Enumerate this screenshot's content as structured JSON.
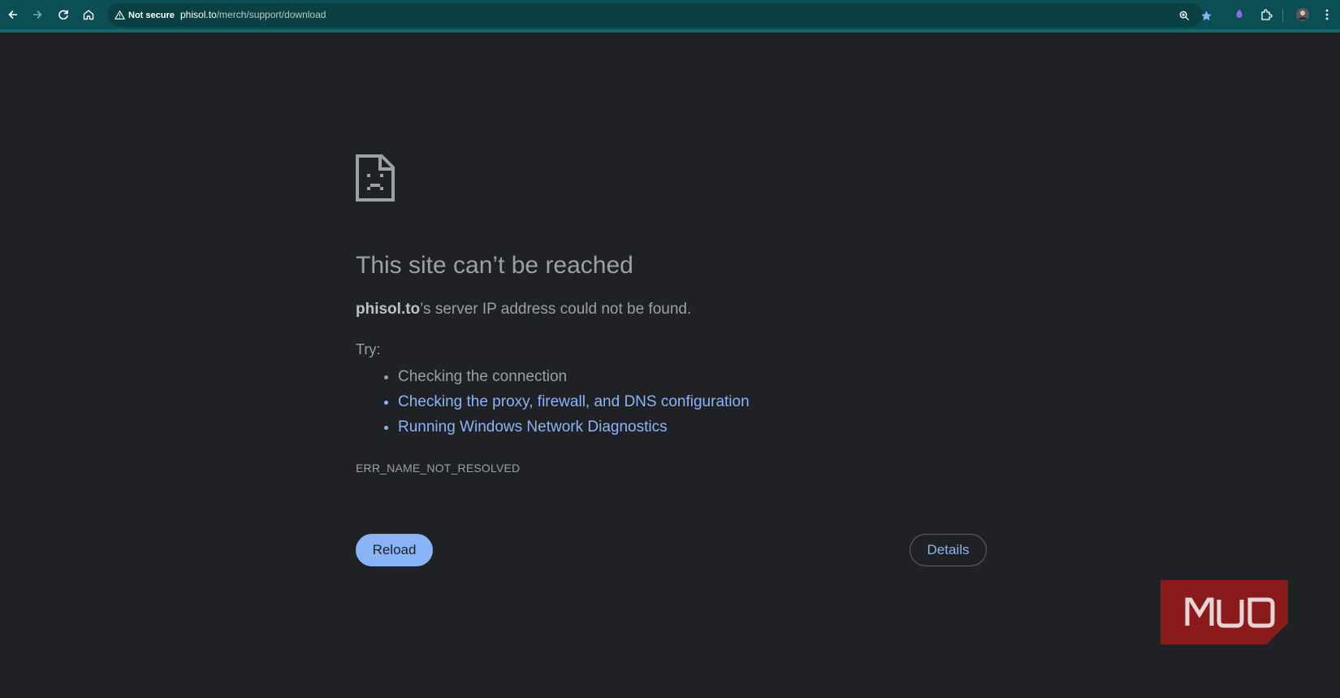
{
  "browser": {
    "security_label": "Not secure",
    "url_host": "phisol.to",
    "url_path": "/merch/support/download"
  },
  "error_page": {
    "title": "This site can’t be reached",
    "host": "phisol.to",
    "summary_rest": "’s server IP address could not be found.",
    "try_label": "Try:",
    "suggestions": [
      "Checking the connection",
      "Checking the proxy, firewall, and DNS configuration",
      "Running Windows Network Diagnostics"
    ],
    "error_code": "ERR_NAME_NOT_RESOLVED",
    "reload_label": "Reload",
    "details_label": "Details"
  },
  "watermark": {
    "text": "MUO"
  },
  "colors": {
    "toolbar": "#0b4f55",
    "page_background": "#202124",
    "link": "#8ab4f8",
    "logo": "#8b1a1a"
  }
}
